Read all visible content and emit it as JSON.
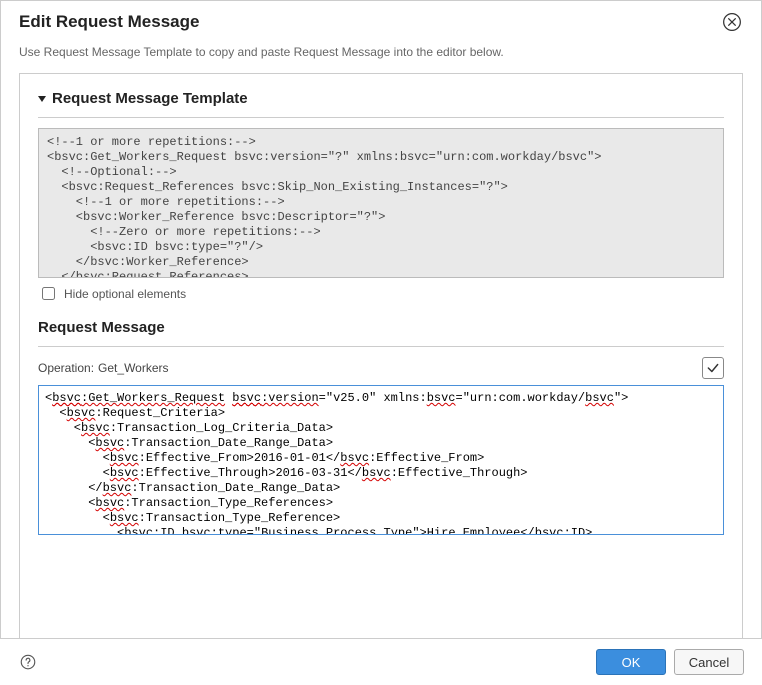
{
  "dialog": {
    "title": "Edit Request Message",
    "subtitle": "Use Request Message Template to copy and paste Request Message into the editor below."
  },
  "template_section": {
    "title": "Request Message Template",
    "hide_optional_label": "Hide optional elements",
    "hide_optional_checked": false,
    "content_lines": [
      "<!--1 or more repetitions:-->",
      "<bsvc:Get_Workers_Request bsvc:version=\"?\" xmlns:bsvc=\"urn:com.workday/bsvc\">",
      "  <!--Optional:-->",
      "  <bsvc:Request_References bsvc:Skip_Non_Existing_Instances=\"?\">",
      "    <!--1 or more repetitions:-->",
      "    <bsvc:Worker_Reference bsvc:Descriptor=\"?\">",
      "      <!--Zero or more repetitions:-->",
      "      <bsvc:ID bsvc:type=\"?\"/>",
      "    </bsvc:Worker_Reference>",
      "  </bsvc:Request_References>"
    ]
  },
  "message_section": {
    "title": "Request Message",
    "operation_label": "Operation:",
    "operation_value": "Get_Workers",
    "content_lines": [
      "<bsvc:Get_Workers_Request bsvc:version=\"v25.0\" xmlns:bsvc=\"urn:com.workday/bsvc\">",
      "  <bsvc:Request_Criteria>",
      "    <bsvc:Transaction_Log_Criteria_Data>",
      "      <bsvc:Transaction_Date_Range_Data>",
      "        <bsvc:Effective_From>2016-01-01</bsvc:Effective_From>",
      "        <bsvc:Effective_Through>2016-03-31</bsvc:Effective_Through>",
      "      </bsvc:Transaction_Date_Range_Data>",
      "      <bsvc:Transaction_Type_References>",
      "        <bsvc:Transaction_Type_Reference>",
      "          <bsvc:ID bsvc:type=\"Business_Process_Type\">Hire_Employee</bsvc:ID>"
    ]
  },
  "footer": {
    "ok_label": "OK",
    "cancel_label": "Cancel"
  }
}
